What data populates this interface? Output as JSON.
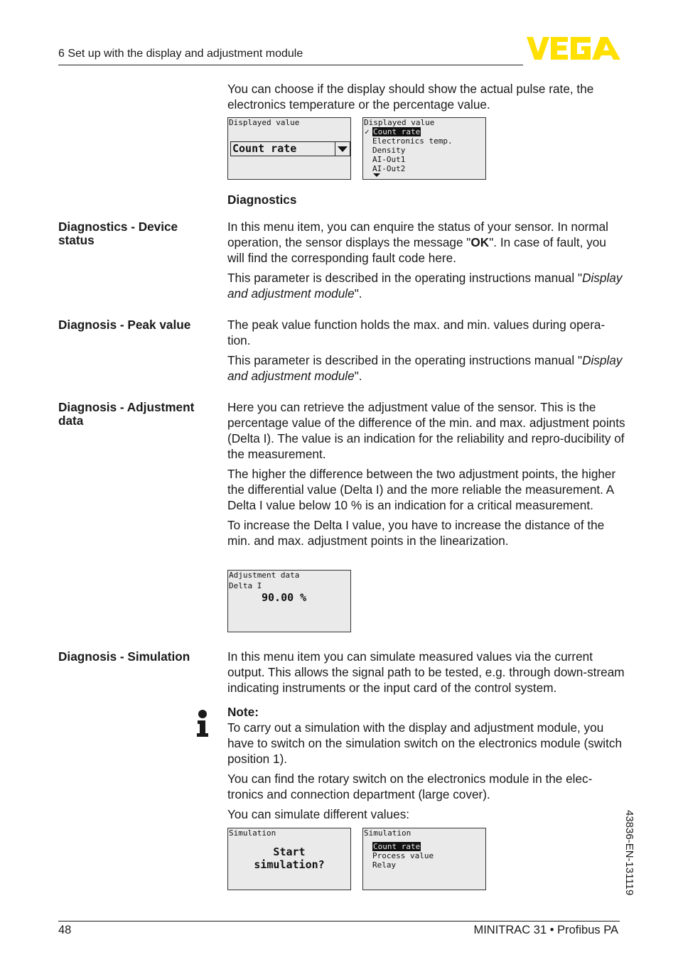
{
  "header": {
    "section_title": "6 Set up with the display and adjustment module",
    "logo_text": "VEGA",
    "logo_color": "#ffe000"
  },
  "intro": {
    "text": "You can choose if the display should show the actual pulse rate, the electronics temperature or the percentage value."
  },
  "lcd_displayed_value_1": {
    "title": "Displayed value",
    "selected": "Count rate"
  },
  "lcd_displayed_value_2": {
    "title": "Displayed value",
    "items": [
      "Count rate",
      "Electronics temp.",
      "Density",
      "AI-Out1",
      "AI-Out2"
    ],
    "checked_item": "Count rate"
  },
  "diagnostics_heading": "Diagnostics",
  "sections": {
    "device_status": {
      "label": "Diagnostics - Device status",
      "p1_a": "In this menu item, you can enquire the status of your sensor. In normal operation, the sensor displays the message \"",
      "p1_bold": "OK",
      "p1_b": "\". In case of fault, you will find the corresponding fault code here.",
      "p2_a": "This parameter is described in the operating instructions manual \"",
      "p2_italic": "Display and adjustment module",
      "p2_b": "\"."
    },
    "peak_value": {
      "label": "Diagnosis - Peak value",
      "p1": "The peak value function holds the max. and min. values during opera-tion.",
      "p2_a": "This parameter is described in the operating instructions manual \"",
      "p2_italic": "Display and adjustment module",
      "p2_b": "\"."
    },
    "adjustment_data": {
      "label": "Diagnosis - Adjustment data",
      "p1": "Here you can retrieve the adjustment value of the sensor. This is the percentage value of the difference of the min. and max. adjustment points (Delta I). The value is an indication for the reliability and repro-ducibility of the measurement.",
      "p2": "The higher the difference between the two adjustment points, the higher the differential value (Delta I) and the more reliable the measurement. A Delta I value below 10 % is an indication for a critical measurement.",
      "p3": "To increase the Delta I value, you have to increase the distance of the min. and max. adjustment points in the linearization."
    },
    "simulation": {
      "label": "Diagnosis - Simulation",
      "p1": "In this menu item you can simulate measured values via the current output. This allows the signal path to be tested, e.g. through down-stream indicating instruments or the input card of the control system.",
      "note_title": "Note:",
      "note_text": "To carry out a simulation with the display and adjustment module, you have to switch on the simulation switch on the electronics module (switch position 1).",
      "p2": "You can find the rotary switch on the electronics module in the elec-tronics and connection department (large cover).",
      "p3": "You can simulate different values:"
    }
  },
  "lcd_adjustment": {
    "title": "Adjustment data",
    "subtitle": "Delta I",
    "value": "90.00 %"
  },
  "lcd_sim_1": {
    "title": "Simulation",
    "line1": "Start",
    "line2": "simulation?"
  },
  "lcd_sim_2": {
    "title": "Simulation",
    "items": [
      "Count rate",
      "Process value",
      "Relay"
    ]
  },
  "footer": {
    "page_number": "48",
    "product": "MINITRAC 31 • Profibus PA",
    "doc_id": "43836-EN-131119"
  }
}
